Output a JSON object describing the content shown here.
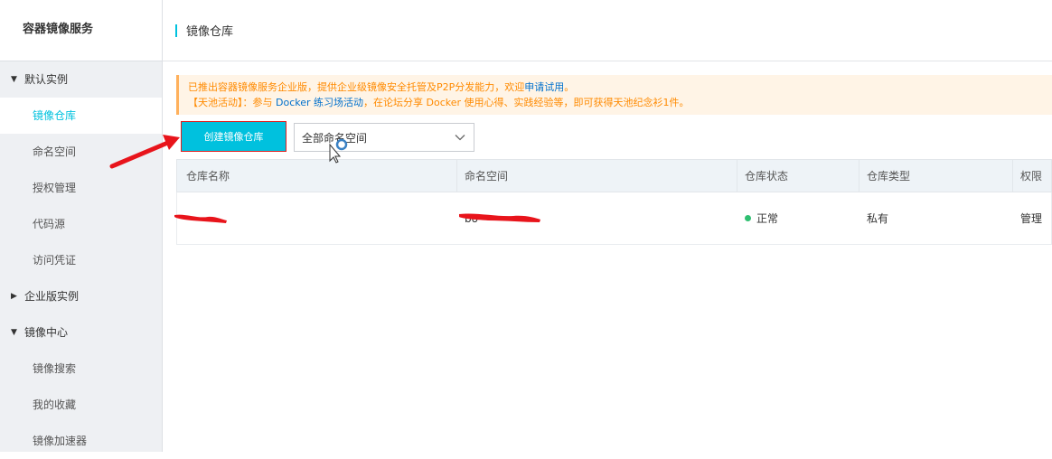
{
  "sidebar": {
    "title": "容器镜像服务",
    "groups": [
      {
        "label": "默认实例",
        "expanded": true,
        "items": [
          {
            "label": "镜像仓库",
            "active": true
          },
          {
            "label": "命名空间"
          },
          {
            "label": "授权管理"
          },
          {
            "label": "代码源"
          },
          {
            "label": "访问凭证"
          }
        ]
      },
      {
        "label": "企业版实例",
        "expanded": false
      },
      {
        "label": "镜像中心",
        "expanded": true,
        "items": [
          {
            "label": "镜像搜索"
          },
          {
            "label": "我的收藏"
          },
          {
            "label": "镜像加速器"
          }
        ]
      }
    ]
  },
  "header": {
    "title": "镜像仓库"
  },
  "notice": {
    "line1_text": "已推出容器镜像服务企业版，提供企业级镜像安全托管及P2P分发能力，欢迎",
    "line1_link": "申请试用",
    "line1_end": "。",
    "line2_prefix": "【天池活动】：参与",
    "line2_link": "Docker 练习场活动",
    "line2_text": "，在论坛分享 Docker 使用心得、实践经验等，即可获得天池纪念衫1件。"
  },
  "toolbar": {
    "create_label": "创建镜像仓库",
    "namespace_select": "全部命名空间"
  },
  "table": {
    "columns": [
      "仓库名称",
      "命名空间",
      "仓库状态",
      "仓库类型",
      "权限"
    ],
    "rows": [
      {
        "name": "",
        "namespace": "bo",
        "status": "正常",
        "type": "私有",
        "permission": "管理"
      }
    ]
  },
  "colors": {
    "accent": "#00c1de",
    "status_ok": "#2fbf71",
    "warn": "#ff8a00",
    "annotation": "#e8141b"
  }
}
